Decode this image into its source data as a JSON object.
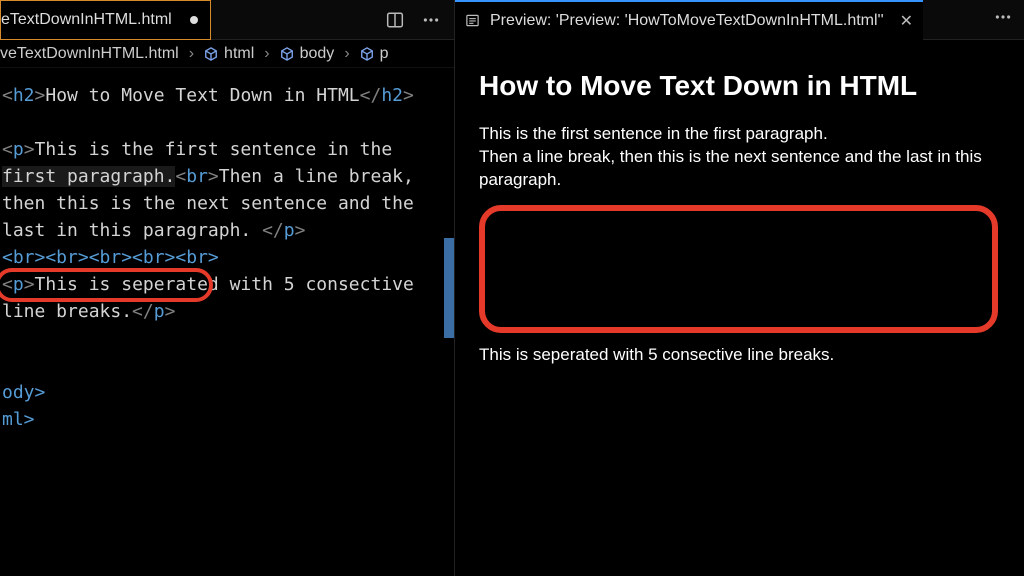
{
  "editor": {
    "tab_label": "eTextDownInHTML.html",
    "breadcrumb": {
      "file": "veTextDownInHTML.html",
      "crumb1": "html",
      "crumb2": "body",
      "crumb3": "p"
    },
    "tokens": {
      "h2_open_b": "<",
      "h2_open_n": "h2",
      "h2_open_e": ">",
      "h2_text": "How to Move Text Down in HTML",
      "h2_close_b": "</",
      "h2_close_n": "h2",
      "h2_close_e": ">",
      "p_open_b": "<",
      "p_open_n": "p",
      "p_open_e": ">",
      "p1a": "This is the first sentence in the ",
      "p1b": "first paragraph.",
      "br_b": "<",
      "br_n": "br",
      "br_e": ">",
      "p1c": "Then a line break, ",
      "p1d": "then this is the next sentence and the ",
      "p1e": "last in this paragraph. ",
      "p_close_b": "</",
      "p_close_n": "p",
      "p_close_e": ">",
      "brseq": "<br><br><br><br><br>",
      "p2a": "This is seperated with 5 consective ",
      "p2b": "line breaks.",
      "body_close": "ody>",
      "html_close": "ml>"
    }
  },
  "preview_tab": {
    "label": "Preview: 'Preview: 'HowToMoveTextDownInHTML.html''"
  },
  "preview": {
    "heading": "How to Move Text Down in HTML",
    "para1_l1": "This is the first sentence in the first paragraph.",
    "para1_l2": "Then a line break, then this is the next sentence and the last in this paragraph.",
    "para2": "This is seperated with 5 consective line breaks."
  }
}
